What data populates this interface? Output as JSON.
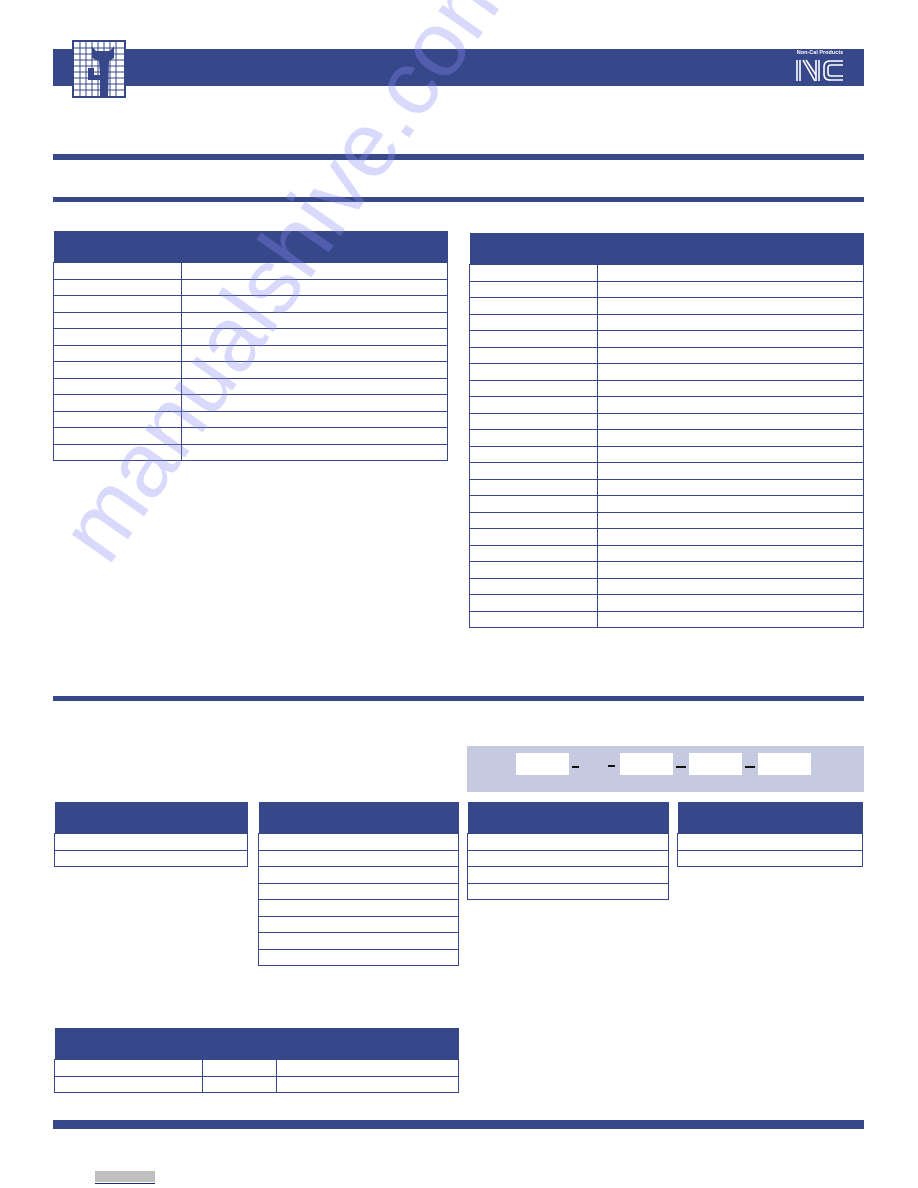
{
  "document": {
    "brand_color": "#37488a",
    "part_number_box_color": "#c6cae0",
    "header": {
      "left_logo": "company-grid-logo",
      "right_logo_caption": "Non-Cal Products",
      "right_logo_mark": "NC"
    },
    "section1": {
      "table_left": {
        "rows": 12,
        "columns": 2,
        "cells": []
      },
      "table_right": {
        "rows": 22,
        "columns": 2,
        "cells": []
      }
    },
    "section2": {
      "part_number": {
        "fields": [
          "",
          "",
          "",
          ""
        ],
        "separators": [
          "-",
          "-",
          "-",
          "-"
        ]
      },
      "tables": [
        {
          "rows": 2,
          "columns": 1,
          "cells": []
        },
        {
          "rows": 8,
          "columns": 1,
          "cells": []
        },
        {
          "rows": 4,
          "columns": 1,
          "cells": []
        },
        {
          "rows": 2,
          "columns": 1,
          "cells": []
        }
      ],
      "bottom_table": {
        "rows": 2,
        "columns": 3,
        "cells": []
      }
    },
    "watermark": "manualshive.com"
  }
}
